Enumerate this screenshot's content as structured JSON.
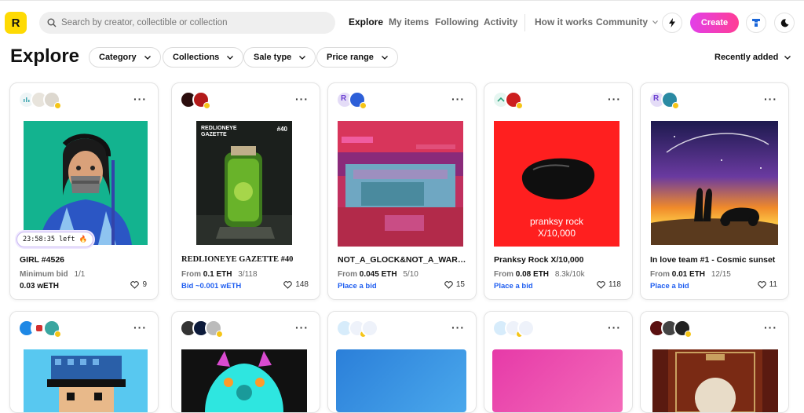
{
  "app": {
    "logo_letter": "R",
    "brand_color": "#FEDA03",
    "accent": "#1f5ef0"
  },
  "search": {
    "placeholder": "Search by creator, collectible or collection"
  },
  "nav": {
    "items": [
      {
        "label": "Explore",
        "active": true
      },
      {
        "label": "My items"
      },
      {
        "label": "Following"
      },
      {
        "label": "Activity"
      },
      {
        "label": "How it works"
      },
      {
        "label": "Community"
      }
    ],
    "create_label": "Create",
    "icons": [
      "bolt-icon",
      "rari-token-icon",
      "moon-icon"
    ]
  },
  "page": {
    "title": "Explore"
  },
  "filters": [
    {
      "label": "Category"
    },
    {
      "label": "Collections"
    },
    {
      "label": "Sale type"
    },
    {
      "label": "Price range"
    }
  ],
  "sort": {
    "label": "Recently added"
  },
  "cards": [
    {
      "name": "GIRL #4526",
      "price_prefix": "Minimum bid",
      "price": "",
      "edition": "1/1",
      "line2": "0.03 wETH",
      "likes": "9",
      "timer": "23:58:35 left 🔥"
    },
    {
      "name": "REDLIONEYE GAZETTE #40",
      "price_prefix": "From",
      "price": "0.1 ETH",
      "edition": "3/118",
      "line2": "Bid ~0.001 wETH",
      "likes": "148"
    },
    {
      "name": "NOT_A_GLOCK&NOT_A_WARHOL",
      "price_prefix": "From",
      "price": "0.045 ETH",
      "edition": "5/10",
      "line2": "Place a bid",
      "likes": "15"
    },
    {
      "name": "Pranksy Rock X/10,000",
      "price_prefix": "From",
      "price": "0.08 ETH",
      "edition": "8.3k/10k",
      "line2": "Place a bid",
      "likes": "118"
    },
    {
      "name": "In love team #1 - Cosmic sunset",
      "price_prefix": "From",
      "price": "0.01 ETH",
      "edition": "12/15",
      "line2": "Place a bid",
      "likes": "11"
    }
  ],
  "art_text": {
    "gazette_title": "REDLIONEYE GAZETTE",
    "gazette_number": "#40",
    "rock_line1": "pranksy rock",
    "rock_line2": "X/10,000"
  }
}
